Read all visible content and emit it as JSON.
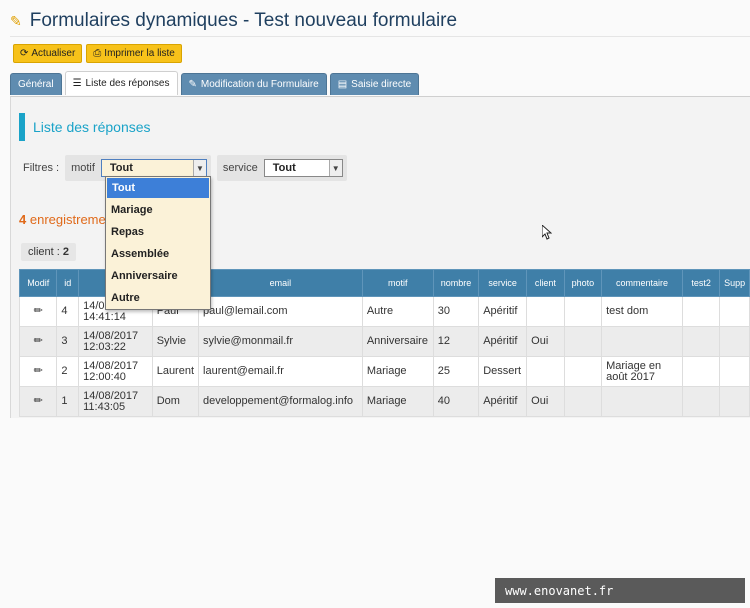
{
  "header": {
    "title": "Formulaires dynamiques - Test nouveau formulaire",
    "icon": "pencil-icon"
  },
  "toolbar": {
    "refresh_label": "Actualiser",
    "print_label": "Imprimer la liste"
  },
  "tabs": [
    {
      "label": "Général",
      "active": false
    },
    {
      "label": "Liste des réponses",
      "active": true
    },
    {
      "label": "Modification du Formulaire",
      "active": false
    },
    {
      "label": "Saisie directe",
      "active": false
    }
  ],
  "section": {
    "title": "Liste des réponses"
  },
  "filters": {
    "label": "Filtres :",
    "motif": {
      "label": "motif",
      "value": "Tout",
      "options": [
        "Tout",
        "Mariage",
        "Repas",
        "Assemblée",
        "Anniversaire",
        "Autre"
      ],
      "open": true
    },
    "service": {
      "label": "service",
      "value": "Tout"
    }
  },
  "records": {
    "count": "4",
    "label": "enregistreme"
  },
  "client_summary": {
    "label": "client :",
    "value": "2"
  },
  "table": {
    "columns": [
      "Modif",
      "id",
      "da",
      "",
      "email",
      "motif",
      "nombre",
      "service",
      "client",
      "photo",
      "commentaire",
      "test2",
      "Supp"
    ],
    "rows": [
      {
        "id": "4",
        "date": "14/0",
        "time": "14:41:14",
        "nom": "Paul",
        "email": "paul@lemail.com",
        "motif": "Autre",
        "nombre": "30",
        "service": "Apéritif",
        "client": "",
        "photo": "",
        "commentaire": "test dom",
        "test2": ""
      },
      {
        "id": "3",
        "date": "14/08/2017",
        "time": "12:03:22",
        "nom": "Sylvie",
        "email": "sylvie@monmail.fr",
        "motif": "Anniversaire",
        "nombre": "12",
        "service": "Apéritif",
        "client": "Oui",
        "photo": "",
        "commentaire": "",
        "test2": ""
      },
      {
        "id": "2",
        "date": "14/08/2017",
        "time": "12:00:40",
        "nom": "Laurent",
        "email": "laurent@email.fr",
        "motif": "Mariage",
        "nombre": "25",
        "service": "Dessert",
        "client": "",
        "photo": "",
        "commentaire": "Mariage en août 2017",
        "test2": ""
      },
      {
        "id": "1",
        "date": "14/08/2017",
        "time": "11:43:05",
        "nom": "Dom",
        "email": "developpement@formalog.info",
        "motif": "Mariage",
        "nombre": "40",
        "service": "Apéritif",
        "client": "Oui",
        "photo": "",
        "commentaire": "",
        "test2": ""
      }
    ]
  },
  "watermark": "www.enovanet.fr",
  "colors": {
    "accent": "#1aa3c8",
    "tab": "#5f8cb0",
    "header": "#3f7fa8",
    "button": "#f7c21a",
    "count": "#e06a1a"
  }
}
